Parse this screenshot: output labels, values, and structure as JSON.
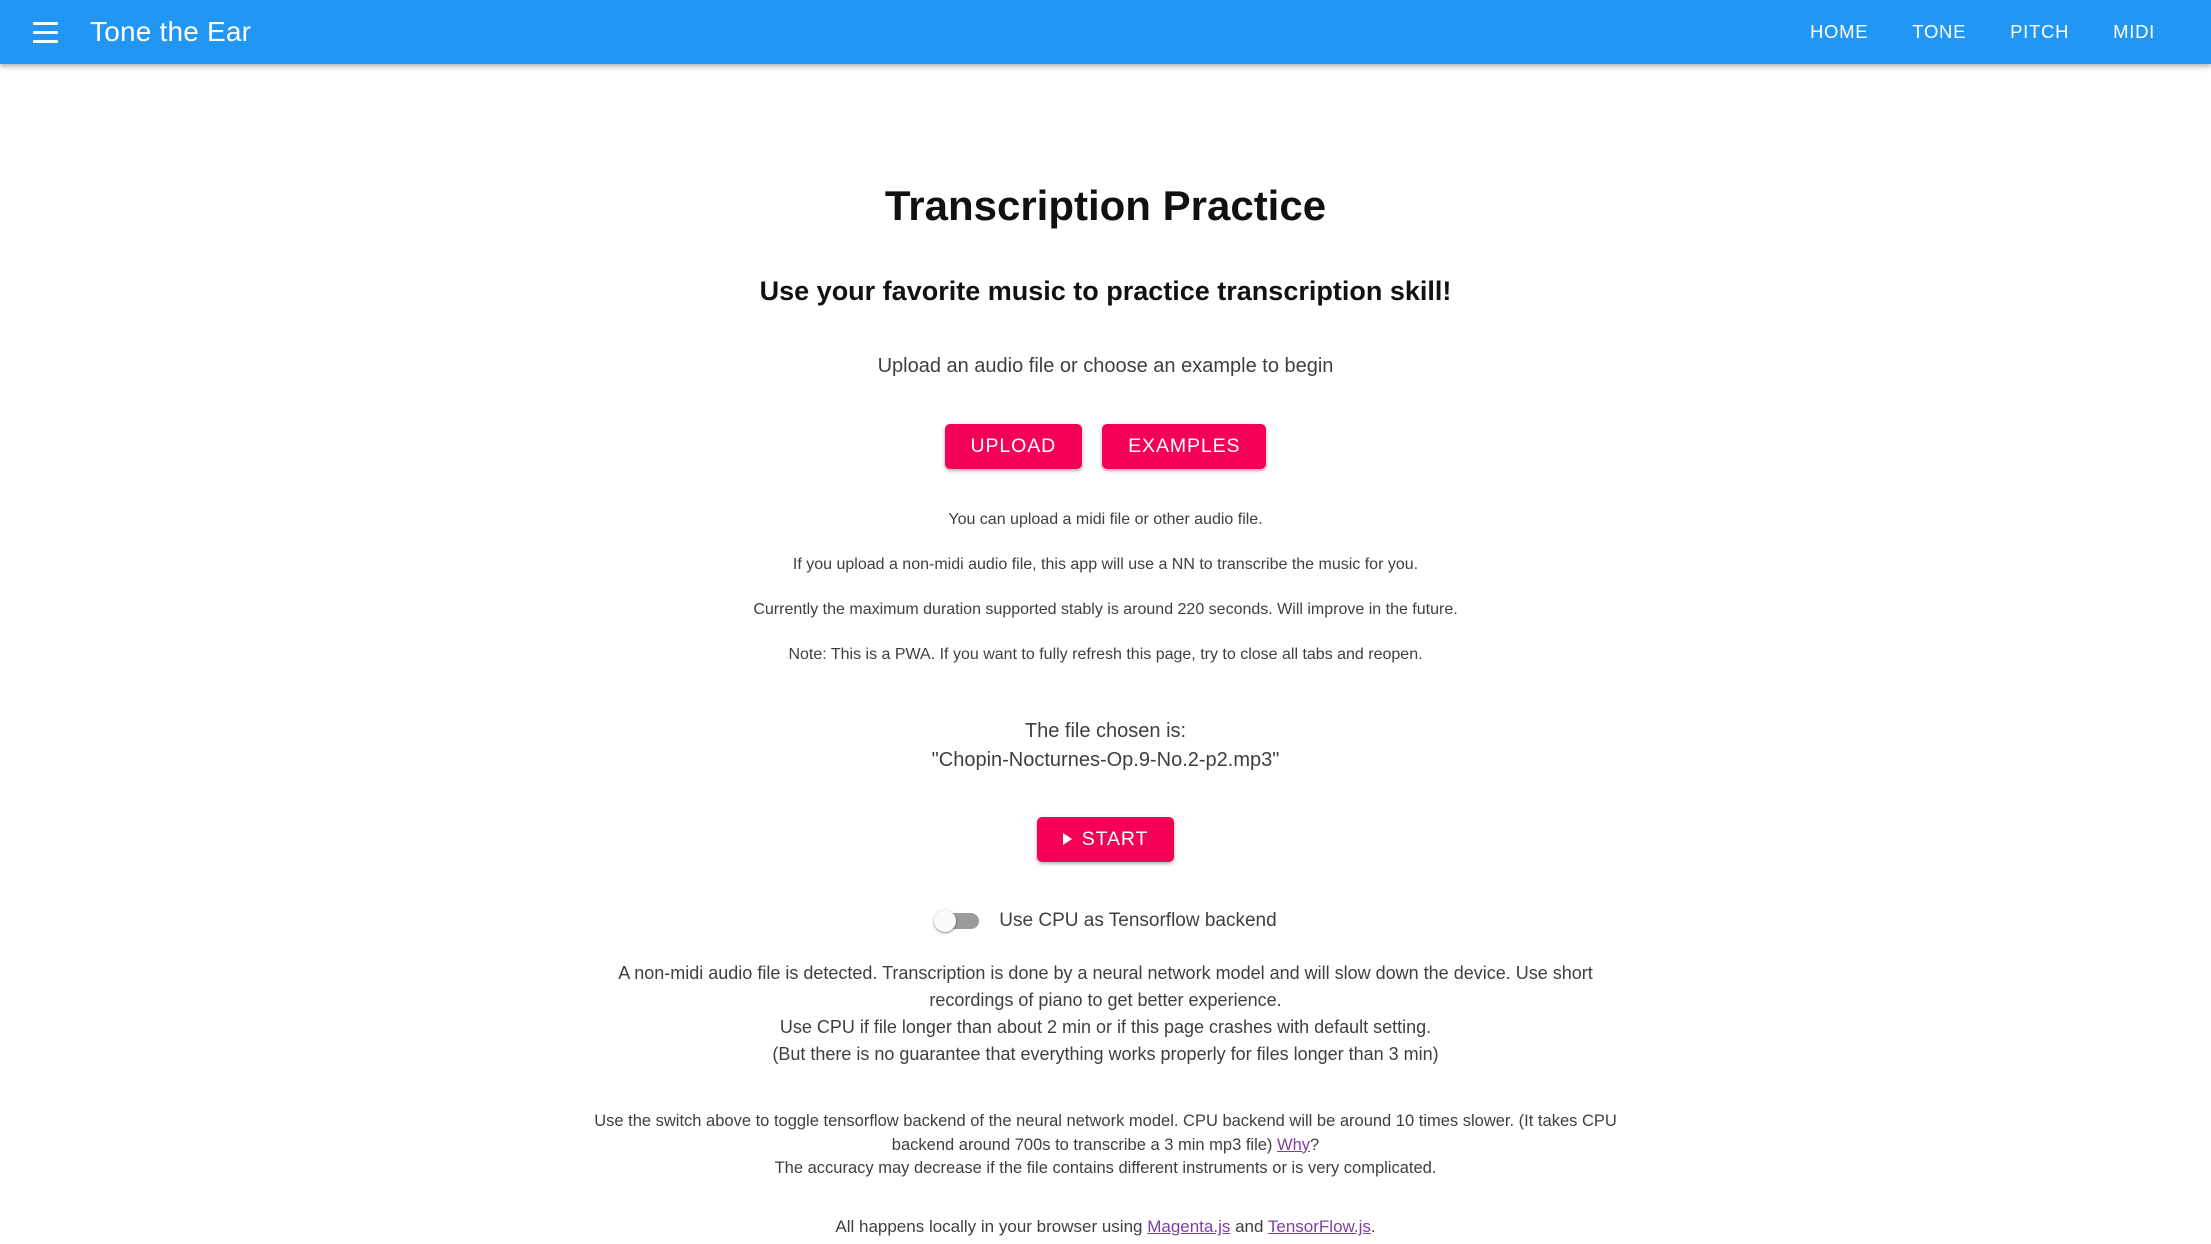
{
  "header": {
    "menu_icon": "hamburger-menu-icon",
    "brand": "Tone the Ear",
    "nav": [
      {
        "label": "HOME"
      },
      {
        "label": "TONE"
      },
      {
        "label": "PITCH"
      },
      {
        "label": "MIDI"
      }
    ],
    "background_color": "#2196f3"
  },
  "main": {
    "title": "Transcription Practice",
    "subtitle": "Use your favorite music to practice transcription skill!",
    "lead": "Upload an audio file or choose an example to begin",
    "buttons": {
      "upload": "UPLOAD",
      "examples": "EXAMPLES",
      "start": "START",
      "start_icon": "play-triangle-icon",
      "accent_color": "#f50057"
    },
    "notes": [
      "You can upload a midi file or other audio file.",
      "If you upload a non-midi audio file, this app will use a NN to transcribe the music for you.",
      "Currently the maximum duration supported stably is around 220 seconds. Will improve in the future.",
      "Note: This is a PWA. If you want to fully refresh this page, try to close all tabs and reopen."
    ],
    "chosen_file": {
      "label": "The file chosen is:",
      "name": "\"Chopin-Nocturnes-Op.9-No.2-p2.mp3\""
    },
    "cpu_switch": {
      "label": "Use CPU as Tensorflow backend",
      "state": "off"
    },
    "detection_paragraph": {
      "line1": "A non-midi audio file is detected. Transcription is done by a neural network model and will slow down the device. Use short recordings of piano to get better experience.",
      "line2": "Use CPU if file longer than about 2 min or if this page crashes with default setting.",
      "line3": "(But there is no guarantee that everything works properly for files longer than 3 min)"
    },
    "backend_paragraph": {
      "part1": "Use the switch above to toggle tensorflow backend of the neural network model. CPU backend will be around 10 times slower. (It takes CPU backend around 700s to transcribe a 3 min mp3 file) ",
      "why_link": "Why",
      "part2": "?",
      "line2": "The accuracy may decrease if the file contains different instruments or is very complicated."
    },
    "footer": {
      "prefix": "All happens locally in your browser using ",
      "link1": "Magenta.js",
      "middle": " and ",
      "link2": "TensorFlow.js",
      "suffix": ".",
      "link_color": "#7b3fa0"
    }
  }
}
